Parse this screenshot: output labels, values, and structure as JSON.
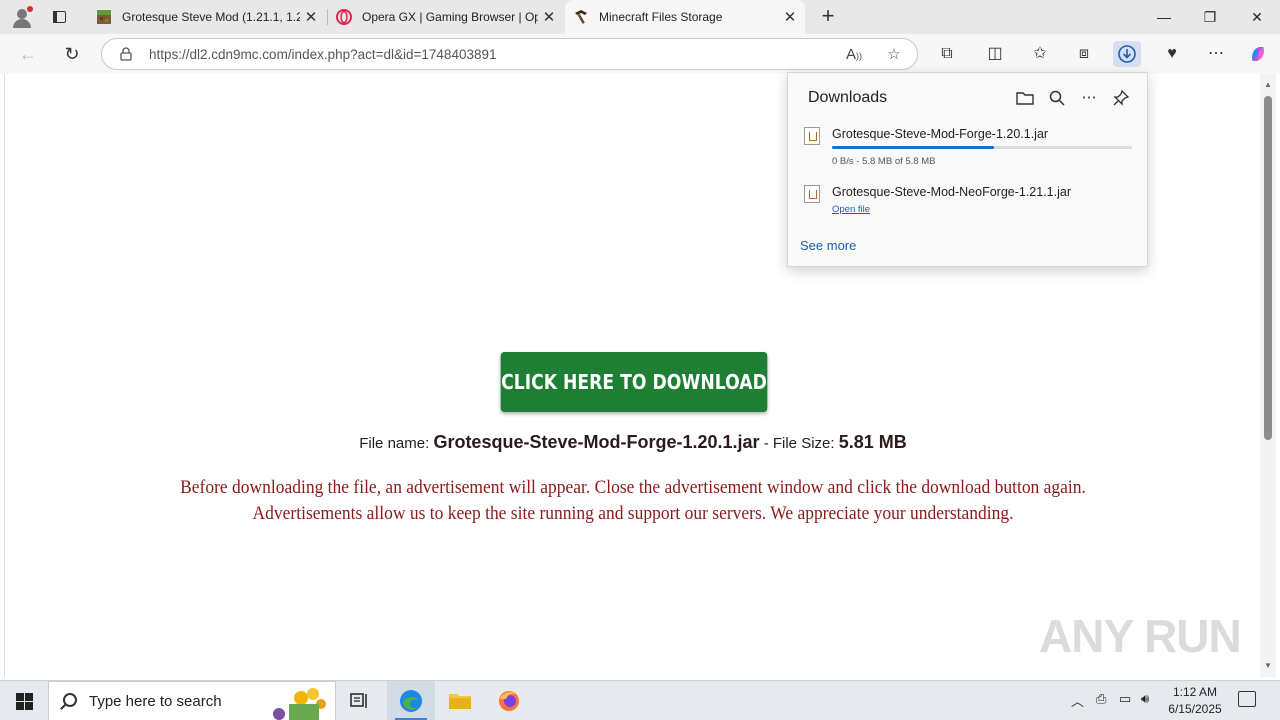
{
  "tabs": [
    {
      "title": "Grotesque Steve Mod (1.21.1, 1.20",
      "close": "✕"
    },
    {
      "title": "Opera GX | Gaming Browser | Ope",
      "close": "✕"
    },
    {
      "title": "Minecraft Files Storage",
      "close": "✕"
    }
  ],
  "new_tab_label": "+",
  "window_controls": {
    "minimize": "—",
    "restore": "❐",
    "close": "✕"
  },
  "address": {
    "url": "https://dl2.cdn9mc.com/index.php?act=dl&id=1748403891"
  },
  "page": {
    "download_button": "CLICK HERE TO DOWNLOAD",
    "file_name_label": "File name:",
    "file_name": "Grotesque-Steve-Mod-Forge-1.20.1.jar",
    "file_size_label": "- File Size:",
    "file_size": "5.81 MB",
    "notice_line1": "Before downloading the file, an advertisement will appear. Close the advertisement window and click the download button again.",
    "notice_line2": "Advertisements allow us to keep the site running and support our servers. We appreciate your understanding.",
    "watermark": "ANY RUN"
  },
  "downloads": {
    "title": "Downloads",
    "items": [
      {
        "name": "Grotesque-Steve-Mod-Forge-1.20.1.jar",
        "status": "0 B/s - 5.8 MB of 5.8 MB",
        "progress": 0.54
      },
      {
        "name": "Grotesque-Steve-Mod-NeoForge-1.21.1.jar",
        "action": "Open file"
      }
    ],
    "see_more": "See more"
  },
  "taskbar": {
    "search_placeholder": "Type here to search",
    "time": "1:12 AM",
    "date": "6/15/2025"
  },
  "colors": {
    "download_button": "#1e7e34",
    "notice_text": "#8b1a1a",
    "progress_fill": "#1a6ec9",
    "link": "#1a5fb4"
  }
}
